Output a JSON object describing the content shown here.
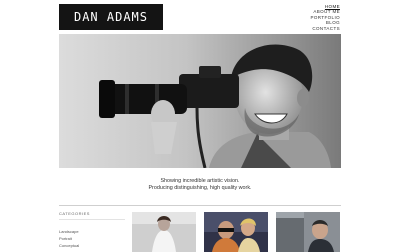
{
  "site": {
    "logo": "DAN ADAMS"
  },
  "nav": {
    "items": [
      "HOME",
      "ABOUT ME",
      "PORTFOLIO",
      "BLOG",
      "CONTACTS"
    ],
    "active": "HOME"
  },
  "hero": {
    "subject": "Laughing photographer holding a camera, black-and-white"
  },
  "tagline": {
    "line1": "Showing incredible artistic vision.",
    "line2": "Producing distinguishing, high quality work."
  },
  "categories": {
    "title": "CATEGORIES",
    "items": [
      "Landscape",
      "Portrait",
      "Conceptual"
    ]
  },
  "thumbnails": [
    {
      "subject": "woman in white dress"
    },
    {
      "subject": "couple with sunglasses"
    },
    {
      "subject": "man in car"
    }
  ]
}
